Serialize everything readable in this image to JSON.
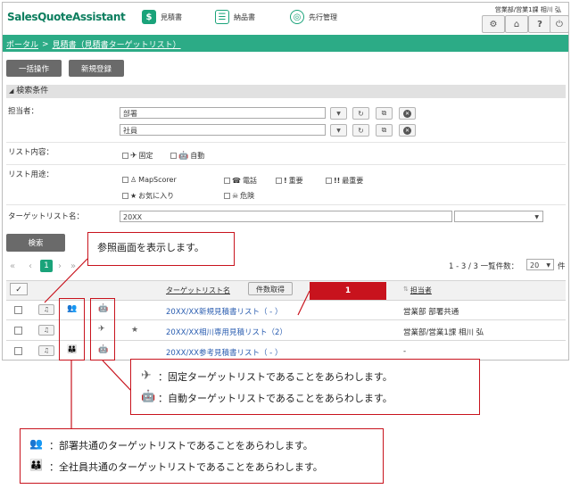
{
  "app": {
    "logo": "SalesQuoteAssistant",
    "user_info": "営業部/営業1課 相川 弘",
    "nav": [
      {
        "label": "見積書",
        "icon": "quote-icon"
      },
      {
        "label": "納品書",
        "icon": "delivery-icon"
      },
      {
        "label": "先行管理",
        "icon": "target-icon"
      }
    ]
  },
  "breadcrumb": {
    "root": "ポータル",
    "sep": ">",
    "current": "見積書（見積書ターゲットリスト）"
  },
  "toolbar": {
    "bulk": "一括操作",
    "new": "新規登録"
  },
  "search": {
    "title": "検索条件",
    "owner_label": "担当者：",
    "dept_placeholder": "部署",
    "staff_placeholder": "社員",
    "content_label": "リスト内容：",
    "content_options": [
      "固定",
      "自動"
    ],
    "usage_label": "リスト用途：",
    "usage_options": [
      "MapScorer",
      "電話",
      "重要",
      "最重要",
      "お気に入り",
      "危険"
    ],
    "name_label": "ターゲットリスト名：",
    "name_value": "20XX",
    "search_button": "検索"
  },
  "paging": {
    "prev2": "«",
    "prev": "‹",
    "page": "1",
    "next": "›",
    "next2": "»",
    "range": "1 - 3 / 3 一覧件数：",
    "per_page": "20",
    "unit": "件"
  },
  "table": {
    "col_name": "ターゲットリスト名",
    "fetch_button": "件数取得",
    "col_owner": "担当者",
    "rows": [
      {
        "name": "20XX/XX新規見積書リスト（ - ）",
        "owner": "営業部 部署共通",
        "star": ""
      },
      {
        "name": "20XX/XX相川専用見積リスト（2）",
        "owner": "営業部/営業1課 相川 弘",
        "star": "★"
      },
      {
        "name": "20XX/XX参考見積書リスト（ - ）",
        "owner": "-",
        "star": ""
      }
    ]
  },
  "callouts": {
    "ref": "参照画面を表示します。",
    "badge": "1",
    "fixed": "：固定ターゲットリストであることをあらわします。",
    "auto": "：自動ターゲットリストであることをあらわします。",
    "dept": "：部署共通のターゲットリストであることをあらわします。",
    "all": "：全社員共通のターゲットリストであることをあらわします。"
  }
}
